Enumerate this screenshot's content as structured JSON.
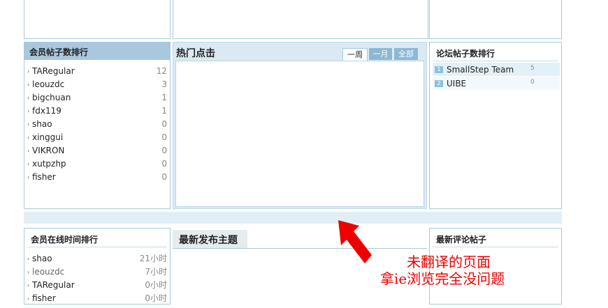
{
  "member_posts": {
    "title": "会员帖子数排行",
    "items": [
      {
        "name": "TARegular",
        "count": "12"
      },
      {
        "name": "leouzdc",
        "count": "3"
      },
      {
        "name": "bigchuan",
        "count": "1"
      },
      {
        "name": "fdx119",
        "count": "1"
      },
      {
        "name": "shao",
        "count": "0"
      },
      {
        "name": "xinggui",
        "count": "0"
      },
      {
        "name": "VIKRON",
        "count": "0"
      },
      {
        "name": "xutpzhp",
        "count": "0"
      },
      {
        "name": "fisher",
        "count": "0"
      }
    ]
  },
  "hot_clicks": {
    "title": "热门点击",
    "tabs": [
      "一周",
      "一月",
      "全部"
    ]
  },
  "forum_posts": {
    "title": "论坛帖子数排行",
    "items": [
      {
        "rank": "1",
        "name": "SmallStep Team",
        "count": "5"
      },
      {
        "rank": "2",
        "name": "UIBE",
        "count": "0"
      }
    ]
  },
  "online_time": {
    "title": "会员在线时间排行",
    "items": [
      {
        "name": "shao",
        "time": "21小时"
      },
      {
        "name": "leouzdc",
        "time": "7小时"
      },
      {
        "name": "TARegular",
        "time": "0小时"
      },
      {
        "name": "fisher",
        "time": "0小时"
      }
    ]
  },
  "latest_topics": {
    "title": "最新发布主题"
  },
  "latest_comments": {
    "title": "最新评论帖子"
  },
  "annotation": {
    "line1": "未翻译的页面",
    "line2": "拿ie浏览完全没问题",
    "color": "#ee0000"
  }
}
